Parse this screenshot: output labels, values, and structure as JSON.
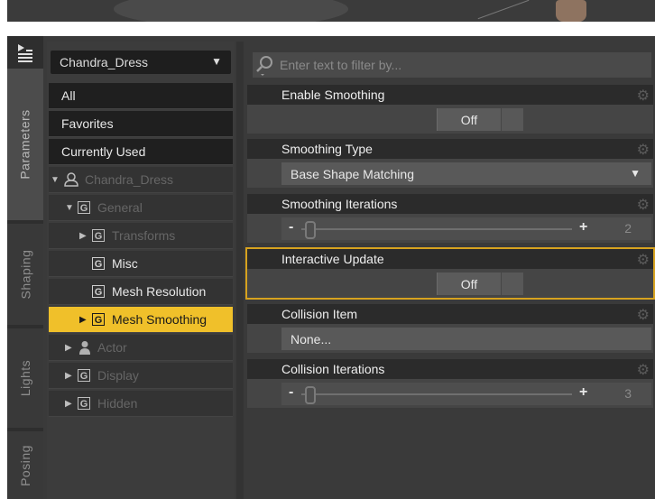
{
  "tabs": [
    "Parameters",
    "Shaping",
    "Lights",
    "Posing"
  ],
  "figure_selector": "Chandra_Dress",
  "tree": {
    "all": "All",
    "favorites": "Favorites",
    "currently_used": "Currently Used",
    "root": "Chandra_Dress",
    "general": "General",
    "transforms": "Transforms",
    "misc": "Misc",
    "mesh_resolution": "Mesh Resolution",
    "mesh_smoothing": "Mesh Smoothing",
    "actor": "Actor",
    "display": "Display",
    "hidden": "Hidden"
  },
  "filter": {
    "placeholder": "Enter text to filter by..."
  },
  "properties": {
    "enable_smoothing": {
      "label": "Enable Smoothing",
      "value": "Off"
    },
    "smoothing_type": {
      "label": "Smoothing Type",
      "value": "Base Shape Matching"
    },
    "smoothing_iterations": {
      "label": "Smoothing Iterations",
      "value": "2",
      "minus": "-",
      "plus": "+"
    },
    "interactive_update": {
      "label": "Interactive Update",
      "value": "Off"
    },
    "collision_item": {
      "label": "Collision Item",
      "value": "None..."
    },
    "collision_iterations": {
      "label": "Collision Iterations",
      "value": "3",
      "minus": "-",
      "plus": "+"
    }
  },
  "colors": {
    "accent": "#f0c02a",
    "highlight_border": "#d6a21f"
  }
}
